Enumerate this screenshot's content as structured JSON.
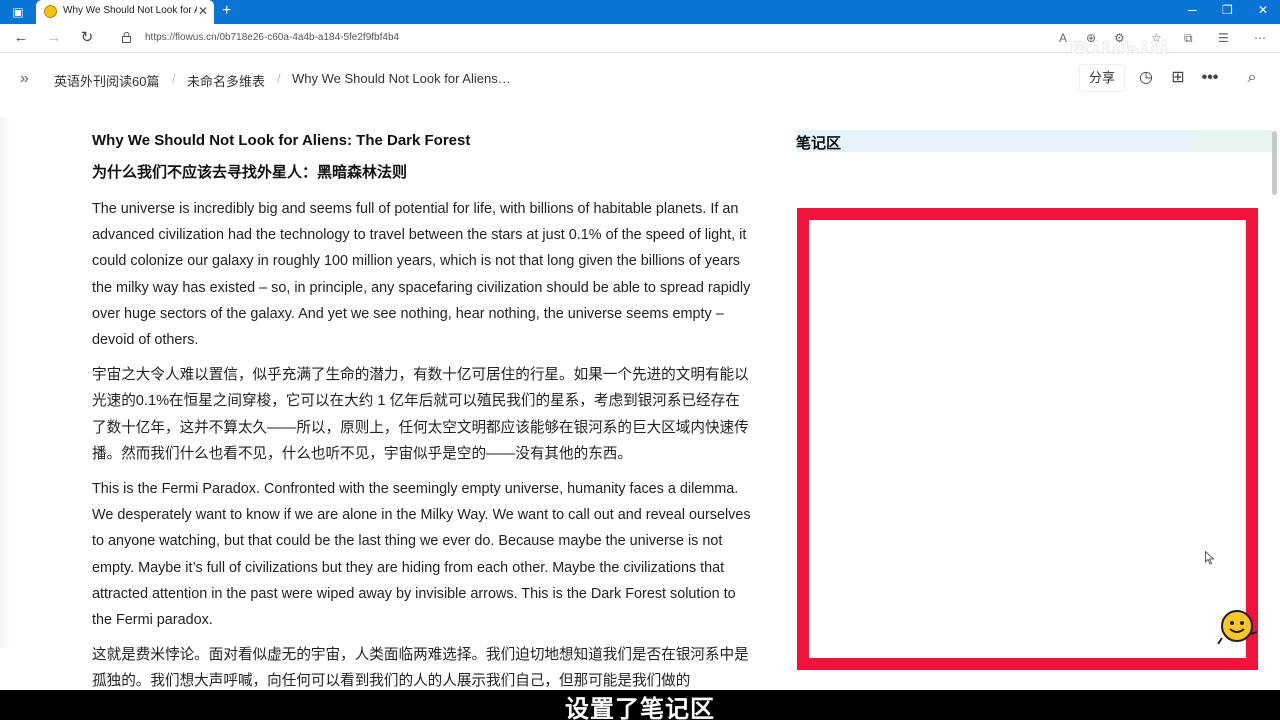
{
  "browser": {
    "tab_title": "Why We Should Not Look for Ali",
    "url": "https://flowus.cn/0b718e26-c60a-4a4b-a184-5fe2f9fbf4b4"
  },
  "header": {
    "breadcrumbs": [
      "英语外刊阅读60篇",
      "未命名多维表",
      "Why We Should Not Look for Aliens…"
    ],
    "share_label": "分享"
  },
  "article": {
    "title_en": "Why We Should Not Look for Aliens: The Dark Forest",
    "title_cn": "为什么我们不应该去寻找外星人：黑暗森林法则",
    "paragraphs": [
      "The universe is incredibly big and seems full of potential for life, with billions of habitable planets. If an advanced civilization had the technology to travel between the stars at just 0.1% of the speed of light, it could colonize our galaxy in roughly 100 million years, which is not that long given the billions of years the milky way has existed – so, in principle, any spacefaring civilization should be able to spread rapidly over huge sectors of the galaxy. And yet we see nothing, hear nothing, the universe seems empty – devoid of others.",
      "宇宙之大令人难以置信，似乎充满了生命的潜力，有数十亿可居住的行星。如果一个先进的文明有能以光速的0.1%在恒星之间穿梭，它可以在大约 1 亿年后就可以殖民我们的星系，考虑到银河系已经存在了数十亿年，这并不算太久——所以，原则上，任何太空文明都应该能够在银河系的巨大区域内快速传播。然而我们什么也看不见，什么也听不见，宇宙似乎是空的——没有其他的东西。",
      "This is the Fermi Paradox. Confronted with the seemingly empty universe, humanity faces a dilemma. We desperately want to know if we are alone in the Milky Way. We want to call out and reveal ourselves to anyone watching, but that could be the last thing we ever do. Because maybe the universe is not empty. Maybe it’s full of civilizations but they are hiding from each other. Maybe the civilizations that attracted attention in the past were wiped away by invisible arrows. This is the Dark Forest solution to the Fermi paradox.",
      "这就是费米悖论。面对看似虚无的宇宙，人类面临两难选择。我们迫切地想知道我们是否在银河系中是孤独的。我们想大声呼喊，向任何可以看到我们的人的人展示我们自己，但那可能是我们做的"
    ]
  },
  "notes": {
    "title": "笔记区"
  },
  "overlay": {
    "watermark": "Bilibili",
    "subtitle": "设置了笔记区"
  }
}
